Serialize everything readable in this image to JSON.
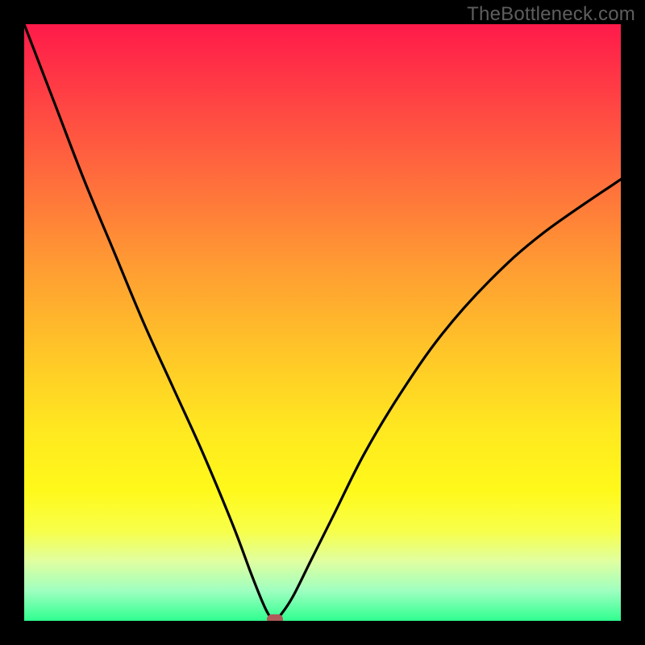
{
  "watermark": "TheBottleneck.com",
  "colors": {
    "background": "#000000",
    "curve": "#000000",
    "marker": "#b05a5a",
    "gradient_top": "#ff1a4a",
    "gradient_bottom": "#2eff8f"
  },
  "chart_data": {
    "type": "line",
    "title": "",
    "xlabel": "",
    "ylabel": "",
    "xlim": [
      0,
      100
    ],
    "ylim": [
      0,
      100
    ],
    "grid": false,
    "series": [
      {
        "name": "bottleneck-curve",
        "x": [
          0,
          5,
          10,
          15,
          20,
          25,
          30,
          35,
          38,
          40,
          41,
          42,
          43,
          45,
          48,
          52,
          57,
          63,
          70,
          78,
          87,
          100
        ],
        "values": [
          100,
          87,
          74,
          62,
          50,
          39,
          28,
          16,
          8,
          3,
          1,
          0,
          1,
          4,
          10,
          18,
          28,
          38,
          48,
          57,
          65,
          74
        ]
      }
    ],
    "annotations": [
      {
        "name": "min-marker",
        "x": 42,
        "y": 0,
        "shape": "rounded-rect",
        "color": "#b05a5a"
      }
    ]
  }
}
